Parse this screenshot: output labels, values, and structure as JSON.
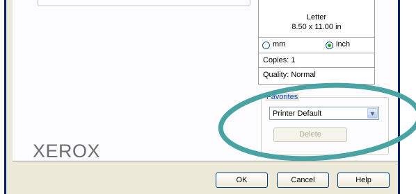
{
  "logo": {
    "text": "XEROX"
  },
  "paper": {
    "name": "Letter",
    "size": "8.50 x 11.00 in"
  },
  "units": {
    "options": [
      {
        "label": "mm",
        "checked": false
      },
      {
        "label": "inch",
        "checked": true
      }
    ]
  },
  "copies": {
    "text": "Copies: 1"
  },
  "quality": {
    "text": "Quality: Normal"
  },
  "favorites": {
    "legend": "Favorites",
    "selected": "Printer Default",
    "delete_label": "Delete"
  },
  "buttons": {
    "ok": "OK",
    "cancel": "Cancel",
    "help": "Help"
  },
  "colors": {
    "annotation_ellipse": "#4aa3a3",
    "accent": "#0046d5"
  }
}
